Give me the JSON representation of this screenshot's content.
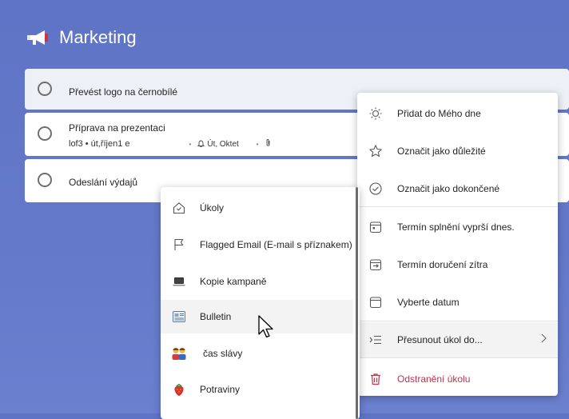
{
  "list": {
    "title": "Marketing",
    "icon": "megaphone-icon"
  },
  "tasks": [
    {
      "title": "Převést logo na černobílé"
    },
    {
      "title": "Příprava na prezentaci",
      "meta_list": "lof3",
      "meta_date": "út,říjen1 e",
      "meta_reminder": "Út, Oktet",
      "attachment_icon": "paperclip-icon"
    },
    {
      "title": "Odeslání výdajů"
    }
  ],
  "context_menu": {
    "items": [
      {
        "label": "Přidat do Mého dne",
        "icon": "sun-icon"
      },
      {
        "label": "Označit jako důležité",
        "icon": "star-icon"
      },
      {
        "label": "Označit jako dokončené",
        "icon": "check-circle-icon"
      },
      {
        "label": "Termín splnění vyprší dnes.",
        "icon": "calendar-today-icon"
      },
      {
        "label": "Termín doručení zítra",
        "icon": "calendar-arrow-icon"
      },
      {
        "label": "Vyberte datum",
        "icon": "calendar-icon"
      },
      {
        "label": "Přesunout úkol do...",
        "icon": "move-list-icon"
      },
      {
        "label": "Odstranění úkolu",
        "icon": "trash-icon",
        "color": "#c4314b"
      }
    ]
  },
  "submenu": {
    "items": [
      {
        "label": "Úkoly",
        "icon": "home-icon"
      },
      {
        "label": "Flagged Email (E-mail s příznakem)",
        "icon": "flag-icon"
      },
      {
        "label": "Kopie kampaně",
        "icon": "laptop-icon"
      },
      {
        "label": "Bulletin",
        "icon": "newspaper-icon"
      },
      {
        "label": "čas slávy",
        "icon": "people-icon"
      },
      {
        "label": "Potraviny",
        "icon": "strawberry-icon"
      }
    ]
  }
}
